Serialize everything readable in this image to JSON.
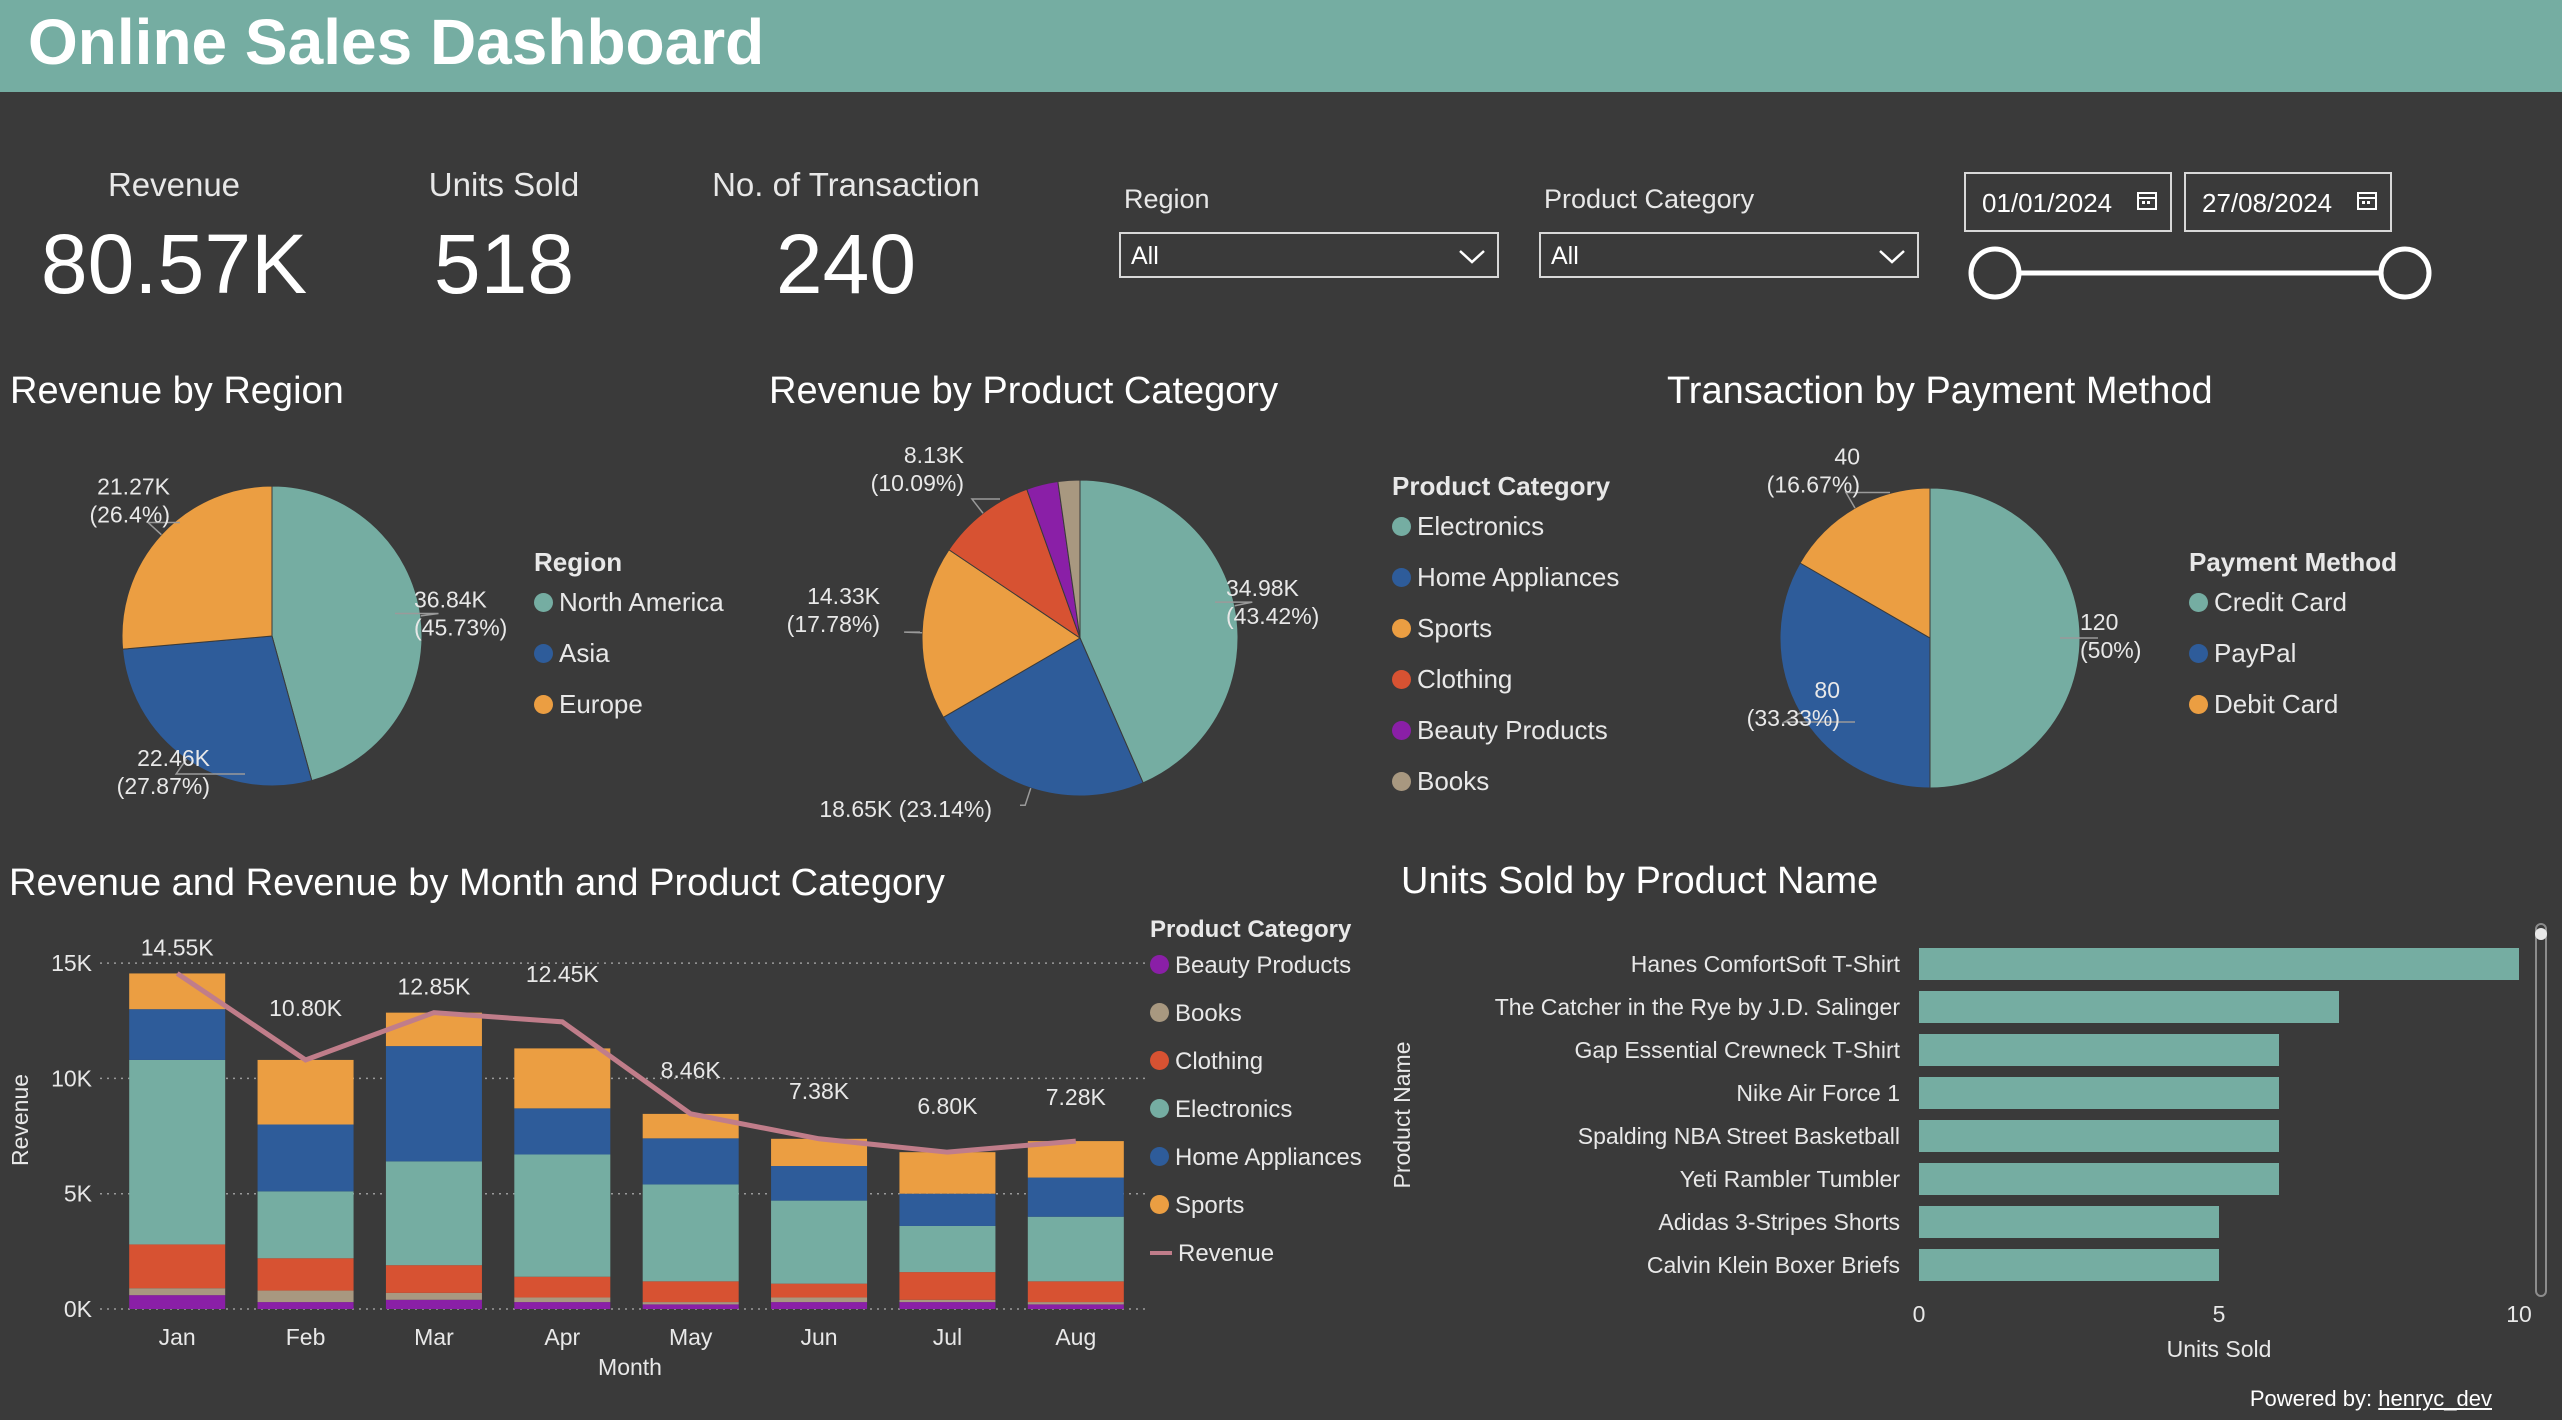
{
  "header": {
    "title": "Online Sales Dashboard"
  },
  "colors": {
    "teal": "#75ada2",
    "blue": "#2e5c9a",
    "orange": "#eb9e42",
    "red": "#d75232",
    "purple": "#8a1fa7",
    "tan": "#a89880",
    "revenue_line": "#c07d8a"
  },
  "kpis": [
    {
      "label": "Revenue",
      "value": "80.57K"
    },
    {
      "label": "Units Sold",
      "value": "518"
    },
    {
      "label": "No. of Transaction",
      "value": "240"
    }
  ],
  "filters": {
    "region": {
      "label": "Region",
      "value": "All",
      "icon": "chevron-down-icon"
    },
    "product_category": {
      "label": "Product Category",
      "value": "All",
      "icon": "chevron-down-icon"
    },
    "date_start": "01/01/2024",
    "date_end": "27/08/2024"
  },
  "revenue_by_region": {
    "title": "Revenue by Region",
    "legend_title": "Region",
    "chart_data": {
      "type": "pie",
      "labels": [
        "North America",
        "Asia",
        "Europe"
      ],
      "values": [
        36.84,
        22.46,
        21.27
      ],
      "data_labels": [
        "36.84K (45.73%)",
        "22.46K (27.87%)",
        "21.27K (26.4%)"
      ],
      "legend_position": "right"
    }
  },
  "revenue_by_category": {
    "title": "Revenue by Product Category",
    "legend_title": "Product Category",
    "chart_data": {
      "type": "pie",
      "labels": [
        "Electronics",
        "Home Appliances",
        "Sports",
        "Clothing",
        "Beauty Products",
        "Books"
      ],
      "values": [
        34.98,
        18.65,
        14.33,
        8.13,
        2.6,
        1.8
      ],
      "data_labels": [
        "34.98K (43.42%)",
        "18.65K (23.14%)",
        "14.33K (17.78%)",
        "8.13K (10.09%)",
        "",
        ""
      ],
      "legend_position": "right"
    }
  },
  "transaction_by_payment": {
    "title": "Transaction by Payment Method",
    "legend_title": "Payment Method",
    "chart_data": {
      "type": "pie",
      "labels": [
        "Credit Card",
        "PayPal",
        "Debit Card"
      ],
      "values": [
        120,
        80,
        40
      ],
      "data_labels": [
        "120 (50%)",
        "80 (33.33%)",
        "40 (16.67%)"
      ],
      "legend_position": "right"
    }
  },
  "revenue_by_month": {
    "title": "Revenue and Revenue by Month and Product Category",
    "legend_title": "Product Category",
    "legend_items": [
      "Beauty Products",
      "Books",
      "Clothing",
      "Electronics",
      "Home Appliances",
      "Sports",
      "Revenue"
    ],
    "chart_data": {
      "type": "bar",
      "stacked": true,
      "categories": [
        "Jan",
        "Feb",
        "Mar",
        "Apr",
        "May",
        "Jun",
        "Jul",
        "Aug"
      ],
      "series": [
        {
          "name": "Beauty Products",
          "values": [
            600,
            300,
            400,
            300,
            200,
            300,
            300,
            200
          ]
        },
        {
          "name": "Books",
          "values": [
            300,
            500,
            300,
            200,
            100,
            200,
            100,
            100
          ]
        },
        {
          "name": "Clothing",
          "values": [
            1900,
            1400,
            1200,
            900,
            900,
            600,
            1200,
            900
          ]
        },
        {
          "name": "Electronics",
          "values": [
            8000,
            2900,
            4500,
            5300,
            4200,
            3600,
            2000,
            2800
          ]
        },
        {
          "name": "Home Appliances",
          "values": [
            2200,
            2900,
            5000,
            2000,
            2000,
            1500,
            1400,
            1700
          ]
        },
        {
          "name": "Sports",
          "values": [
            1550,
            2800,
            1450,
            2600,
            1060,
            1180,
            1800,
            1580
          ]
        }
      ],
      "line": {
        "name": "Revenue",
        "values": [
          14550,
          10800,
          12850,
          12450,
          8460,
          7380,
          6800,
          7280
        ]
      },
      "data_labels": [
        "14.55K",
        "10.80K",
        "12.85K",
        "12.45K",
        "8.46K",
        "7.38K",
        "6.80K",
        "7.28K"
      ],
      "xlabel": "Month",
      "ylabel": "Revenue",
      "ylim": [
        0,
        16000
      ],
      "yticks": [
        0,
        5000,
        10000,
        15000
      ],
      "ytick_labels": [
        "0K",
        "5K",
        "10K",
        "15K"
      ],
      "grid": true,
      "legend_position": "right"
    }
  },
  "units_by_product": {
    "title": "Units Sold by Product Name",
    "chart_data": {
      "type": "bar",
      "orientation": "horizontal",
      "categories": [
        "Hanes ComfortSoft T-Shirt",
        "The Catcher in the Rye by J.D. Salinger",
        "Gap Essential Crewneck T-Shirt",
        "Nike Air Force 1",
        "Spalding NBA Street Basketball",
        "Yeti Rambler Tumbler",
        "Adidas 3-Stripes Shorts",
        "Calvin Klein Boxer Briefs"
      ],
      "values": [
        10,
        7,
        6,
        6,
        6,
        6,
        5,
        5
      ],
      "xlabel": "Units Sold",
      "ylabel": "Product Name",
      "xlim": [
        0,
        10
      ],
      "xticks": [
        0,
        5,
        10
      ]
    }
  },
  "footer": {
    "powered_prefix": "Powered by:",
    "powered_name": "henryc_dev"
  }
}
